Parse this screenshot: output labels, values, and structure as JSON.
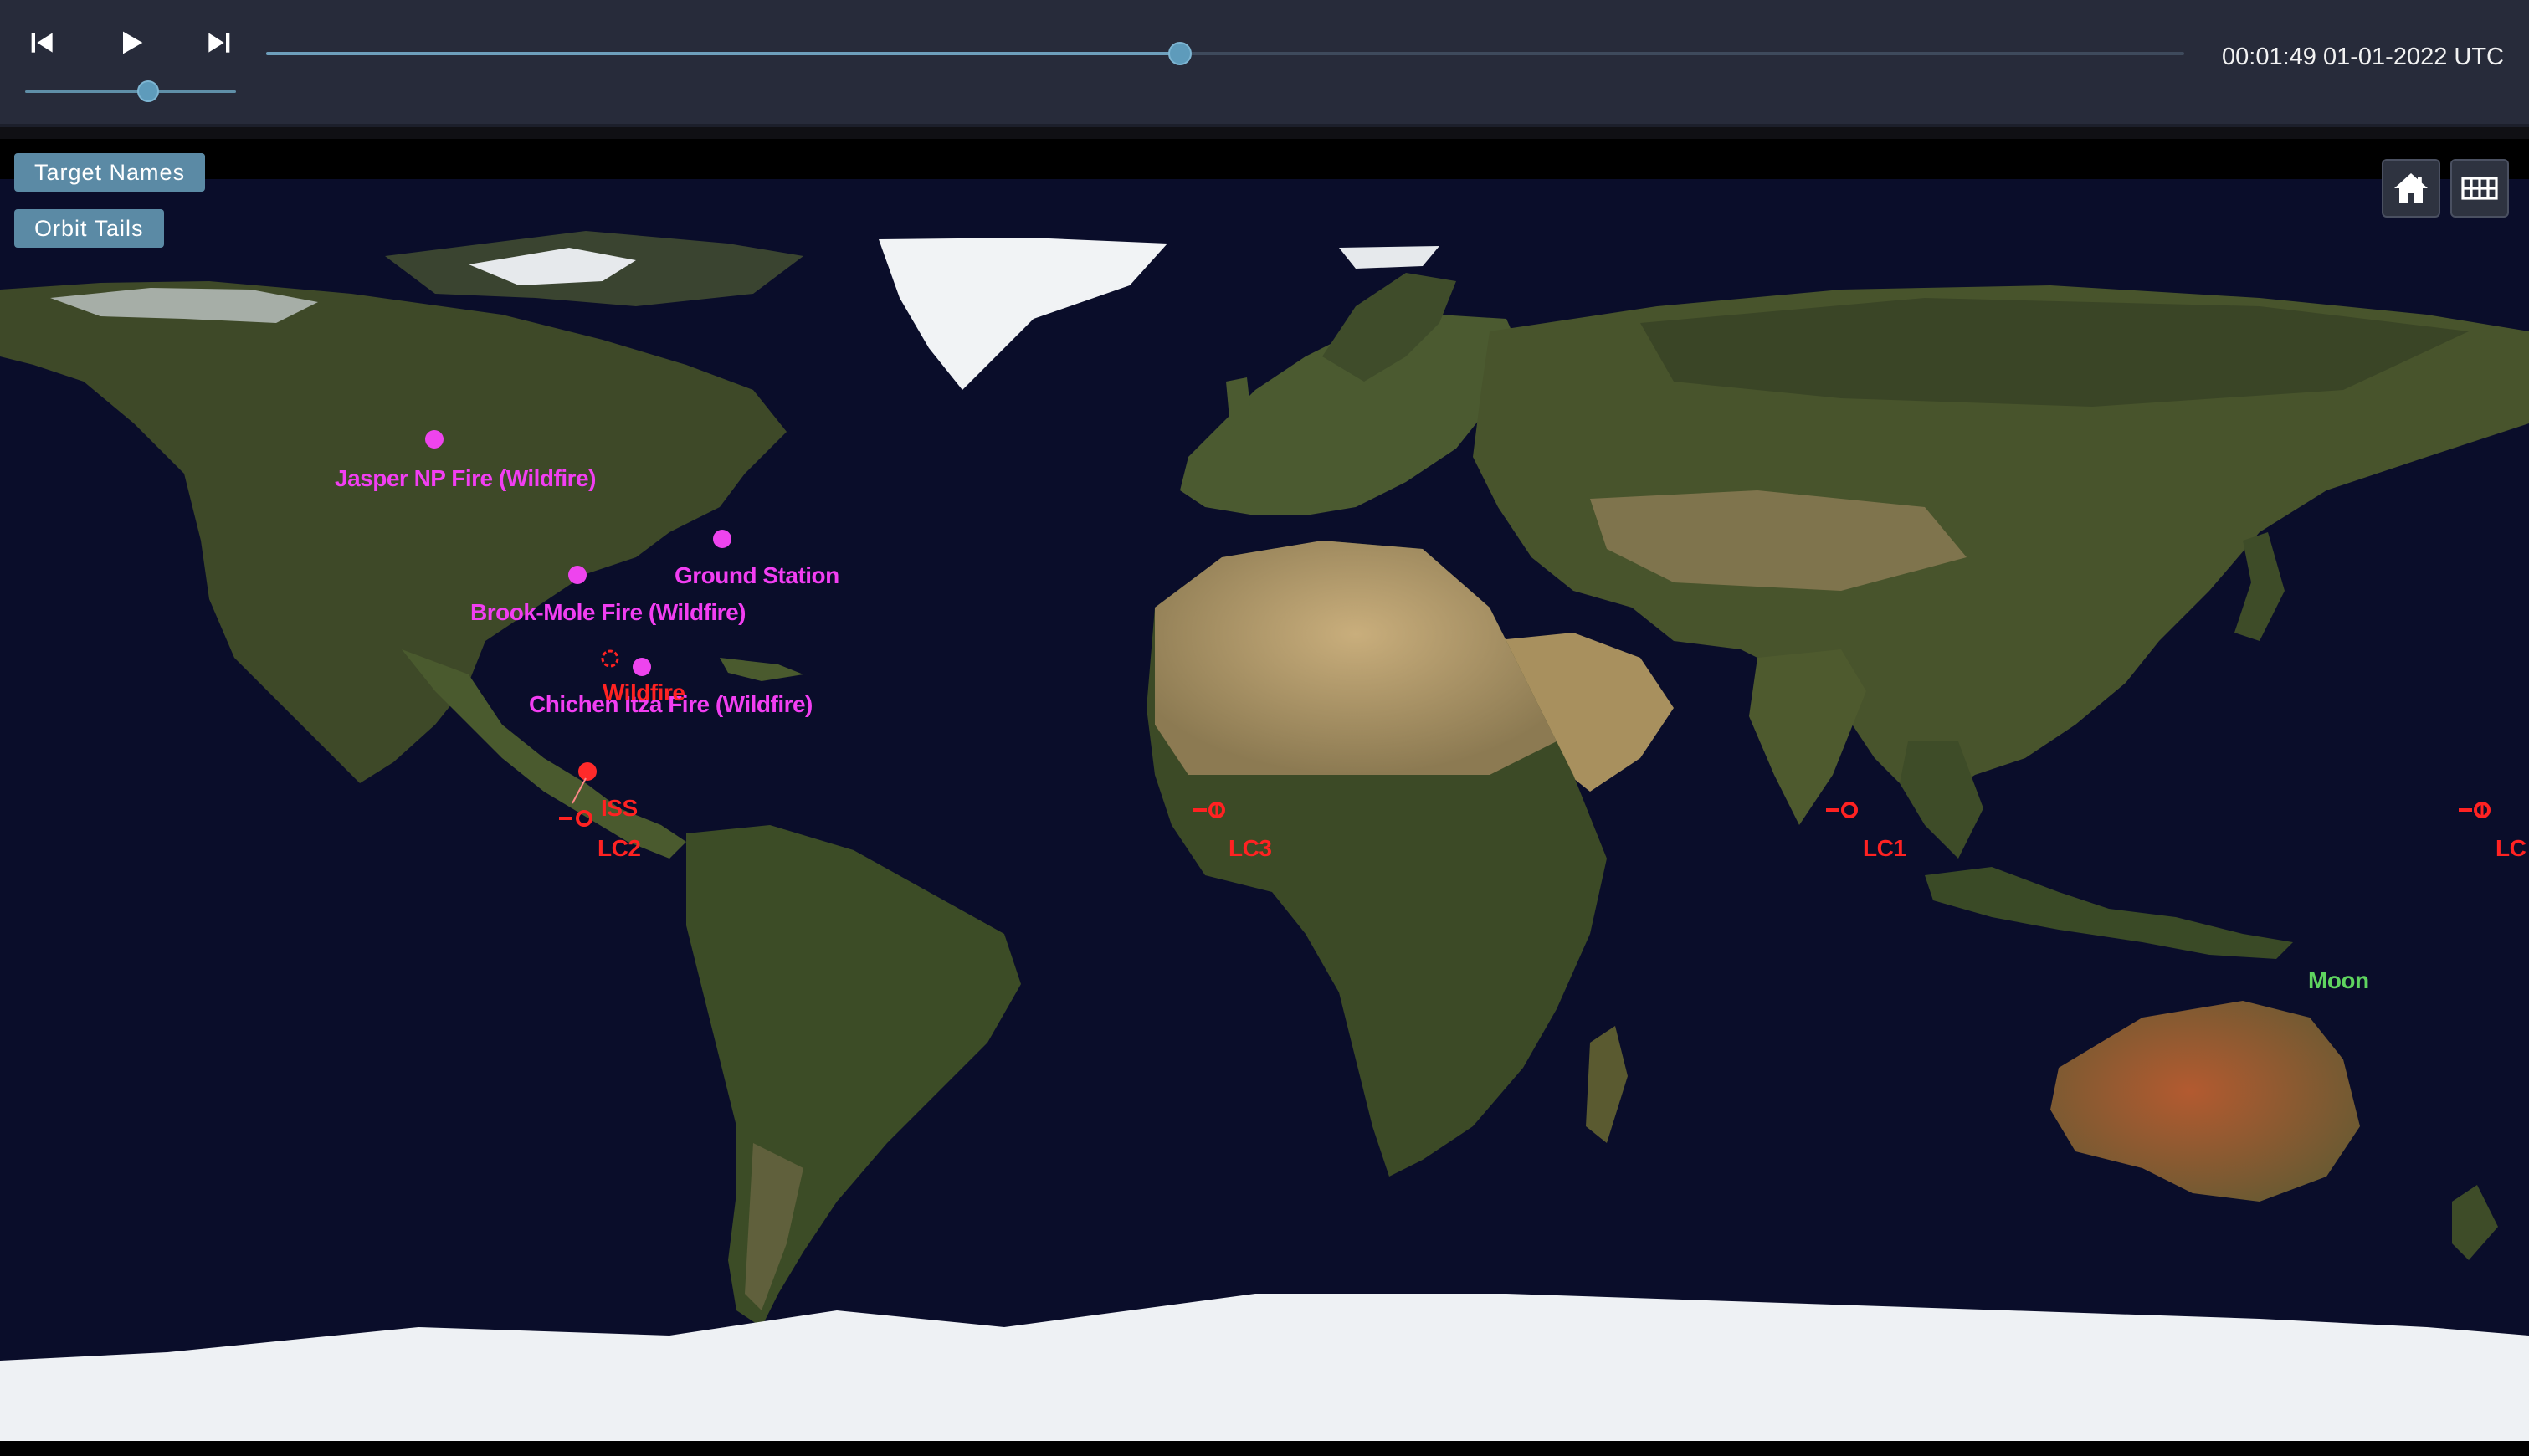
{
  "controls": {
    "skip_back_icon": "skip-back-icon",
    "play_icon": "play-icon",
    "skip_forward_icon": "skip-forward-icon",
    "speed_slider": 0.56,
    "timeline_progress": 0.476,
    "time_label": "00:01:49 01-01-2022 UTC"
  },
  "toggles": {
    "target_names": "Target Names",
    "orbit_tails": "Orbit Tails"
  },
  "view_buttons": {
    "home_icon": "home-icon",
    "grid_icon": "grid-icon"
  },
  "targets": [
    {
      "id": "jasper",
      "label": "Jasper NP Fire (Wildfire)"
    },
    {
      "id": "ground",
      "label": "Ground Station"
    },
    {
      "id": "brook",
      "label": "Brook-Mole Fire (Wildfire)"
    },
    {
      "id": "chichen",
      "label": "Chichen Itza Fire (Wildfire)"
    }
  ],
  "objects": [
    {
      "id": "wildfire",
      "label": "Wildfire"
    },
    {
      "id": "iss",
      "label": "ISS"
    },
    {
      "id": "lc2",
      "label": "LC2"
    },
    {
      "id": "lc3",
      "label": "LC3"
    },
    {
      "id": "lc1",
      "label": "LC1"
    },
    {
      "id": "lc4",
      "label": "LC"
    },
    {
      "id": "moon",
      "label": "Moon"
    }
  ],
  "colors": {
    "bar_bg": "#272b3a",
    "accent": "#5b8aa5",
    "target": "#ee44ee",
    "satellite": "#ff2222",
    "moon": "#5fd45f",
    "ocean": "#0a0d2a",
    "land": "#3f4a2a",
    "desert": "#b49a6a",
    "ice": "#e8ecf0"
  }
}
